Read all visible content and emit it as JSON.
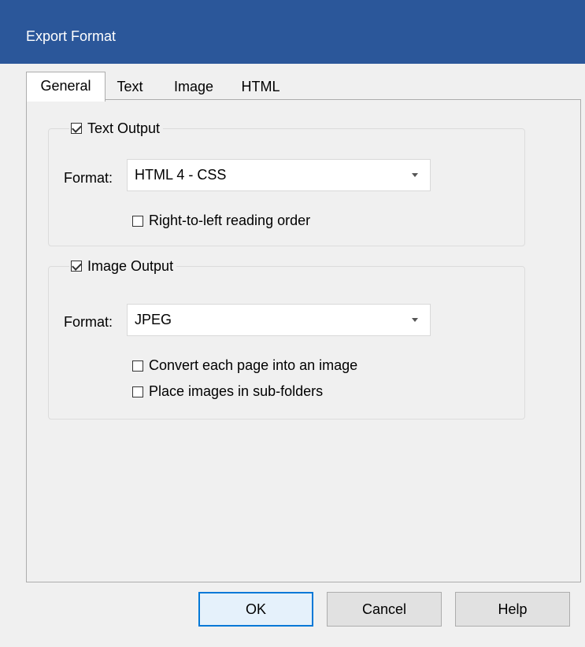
{
  "window": {
    "title": "Export Format"
  },
  "tabs": [
    {
      "label": "General",
      "active": true
    },
    {
      "label": "Text",
      "active": false
    },
    {
      "label": "Image",
      "active": false
    },
    {
      "label": "HTML",
      "active": false
    }
  ],
  "text_output": {
    "legend": "Text Output",
    "checked": true,
    "format_label": "Format:",
    "format_value": "HTML 4 - CSS",
    "rtl_label": "Right-to-left reading order",
    "rtl_checked": false
  },
  "image_output": {
    "legend": "Image Output",
    "checked": true,
    "format_label": "Format:",
    "format_value": "JPEG",
    "convert_label": "Convert each page into an image",
    "convert_checked": false,
    "subfolders_label": "Place images in sub-folders",
    "subfolders_checked": false
  },
  "buttons": {
    "ok": "OK",
    "cancel": "Cancel",
    "help": "Help"
  },
  "colors": {
    "titlebar": "#2b579a",
    "default_button_border": "#0078d7"
  }
}
